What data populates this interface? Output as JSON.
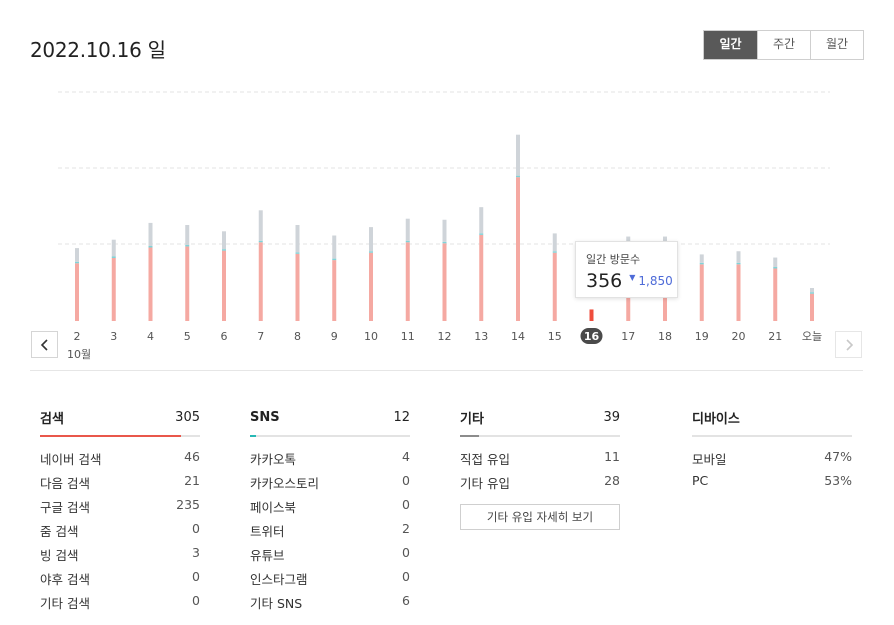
{
  "header": {
    "date": "2022.10.16 일"
  },
  "period_tabs": [
    {
      "label": "일간",
      "active": true
    },
    {
      "label": "주간",
      "active": false
    },
    {
      "label": "월간",
      "active": false
    }
  ],
  "nav": {
    "prev_icon": "chevron-left-icon",
    "next_icon": "chevron-right-icon"
  },
  "month_label": "10월",
  "colors": {
    "bar_main": "#f5a9a2",
    "bar_stack": "#cfd4d9",
    "bar_accent": "#7fd3d8",
    "selected_bar": "#ef4d3c",
    "selected_label_bg": "#4a4a4a",
    "search": "#e9574b",
    "sns": "#27b8b5",
    "other": "#8c8c8c",
    "average": "#4e6bd8"
  },
  "tooltip": {
    "label": "일간 방문수",
    "value": "356",
    "arrow_icon": "caret-down-icon",
    "average": "1,850"
  },
  "chart_data": {
    "type": "bar",
    "categories": [
      "2",
      "3",
      "4",
      "5",
      "6",
      "7",
      "8",
      "9",
      "10",
      "11",
      "12",
      "13",
      "14",
      "15",
      "16",
      "17",
      "18",
      "19",
      "20",
      "21",
      "오늘"
    ],
    "series": [
      {
        "values": [
          55,
          60,
          70,
          71,
          67,
          75,
          64,
          58,
          65,
          75,
          74,
          82,
          137,
          65,
          11,
          62,
          62,
          54,
          54,
          50,
          26
        ]
      },
      {
        "values": [
          13,
          16,
          22,
          19,
          17,
          29,
          26,
          22,
          23,
          21,
          21,
          25,
          39,
          17,
          0,
          17,
          17,
          8,
          11,
          9,
          4
        ]
      }
    ],
    "selected_index": 14,
    "grid": true
  },
  "stats": [
    {
      "title": "검색",
      "total": "305",
      "fill_ratio": 0.88,
      "color_key": "search",
      "items": [
        {
          "label": "네이버 검색",
          "value": "46"
        },
        {
          "label": "다음 검색",
          "value": "21"
        },
        {
          "label": "구글 검색",
          "value": "235"
        },
        {
          "label": "줌 검색",
          "value": "0"
        },
        {
          "label": "빙 검색",
          "value": "3"
        },
        {
          "label": "야후 검색",
          "value": "0"
        },
        {
          "label": "기타 검색",
          "value": "0"
        }
      ]
    },
    {
      "title": "SNS",
      "total": "12",
      "fill_ratio": 0.04,
      "color_key": "sns",
      "items": [
        {
          "label": "카카오톡",
          "value": "4"
        },
        {
          "label": "카카오스토리",
          "value": "0"
        },
        {
          "label": "페이스북",
          "value": "0"
        },
        {
          "label": "트위터",
          "value": "2"
        },
        {
          "label": "유튜브",
          "value": "0"
        },
        {
          "label": "인스타그램",
          "value": "0"
        },
        {
          "label": "기타 SNS",
          "value": "6"
        }
      ]
    },
    {
      "title": "기타",
      "total": "39",
      "fill_ratio": 0.12,
      "color_key": "other",
      "items": [
        {
          "label": "직접 유입",
          "value": "11"
        },
        {
          "label": "기타 유입",
          "value": "28"
        }
      ],
      "button": "기타 유입 자세히 보기"
    },
    {
      "title": "디바이스",
      "total": "",
      "fill_ratio": 0,
      "color_key": "other",
      "items": [
        {
          "label": "모바일",
          "value": "47%"
        },
        {
          "label": "PC",
          "value": "53%"
        }
      ]
    }
  ]
}
